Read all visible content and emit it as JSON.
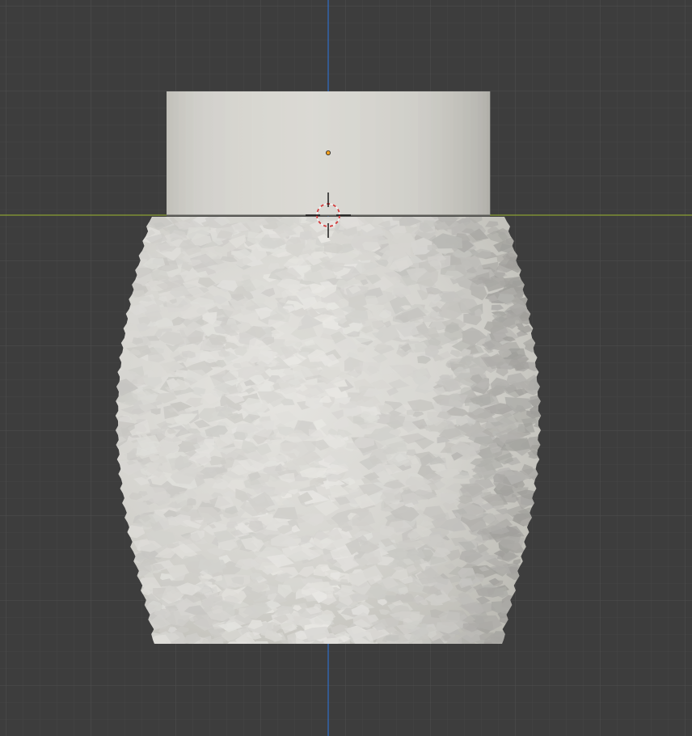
{
  "viewport": {
    "view": "front-orthographic",
    "colors": {
      "background": "#3d3d3d",
      "grid_minor": "#454545",
      "grid_major": "#525252",
      "axis_x": "#8aa033",
      "axis_z": "#2f6fc8",
      "mesh_light": "#e4e3df",
      "mesh_mid": "#c9c8c2",
      "mesh_dark": "#b3b2ab",
      "origin": "#f0a020",
      "cursor_red": "#d23a3a",
      "cursor_white": "#f2f2f2",
      "cursor_black": "#111111"
    },
    "objects": {
      "lid": "cylinder-mesh",
      "body": "textured-vase-mesh"
    },
    "icons": {
      "origin": "object-origin-icon",
      "cursor": "3d-cursor-icon"
    }
  }
}
